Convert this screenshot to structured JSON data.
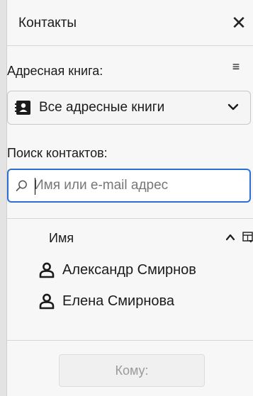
{
  "header": {
    "title": "Контакты",
    "close_glyph": "✕",
    "close_icon": "close-icon"
  },
  "address_book": {
    "label": "Адресная книга:",
    "menu_glyph": "≡",
    "selected": "Все адресные книги",
    "book_icon": "address-book-icon",
    "chevron_icon": "chevron-down-icon"
  },
  "search": {
    "label": "Поиск контактов:",
    "placeholder": "Имя или e-mail адрес",
    "value": "",
    "icon": "search-icon"
  },
  "list": {
    "column_name": "Имя",
    "sort_direction": "ascending",
    "contacts": [
      "Александр Смирнов",
      "Елена Смирнова"
    ],
    "contact_icon": "person-icon"
  },
  "footer": {
    "to_button_label": "Кому:",
    "to_button_enabled": false
  },
  "colors": {
    "accent": "#2b6fd6",
    "panel_bg": "#f7f7f7",
    "border": "#d6d6d6"
  }
}
